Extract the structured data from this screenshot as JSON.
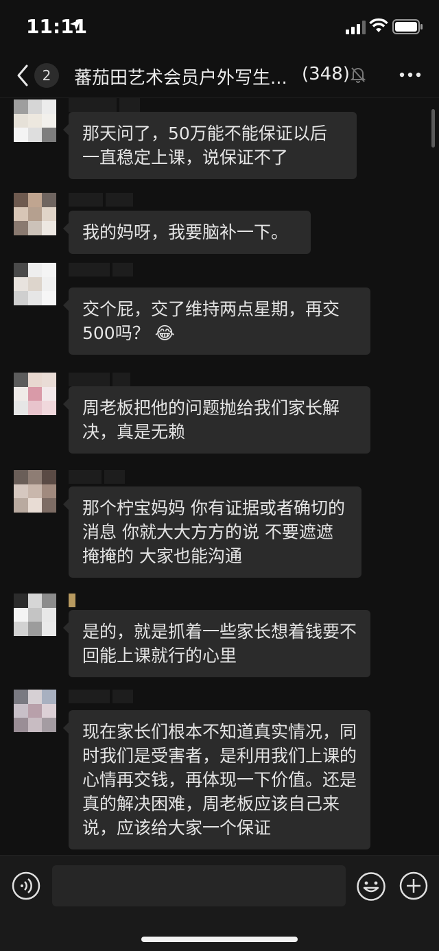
{
  "status_bar": {
    "time": "11:11"
  },
  "nav": {
    "unread_badge": "2",
    "title": "蕃茄田艺术会员户外写生...",
    "member_count": "(348)"
  },
  "messages": [
    {
      "text": "那天问了，50万能不能保证以后一直稳定上课，说保证不了"
    },
    {
      "text": "我的妈呀，我要脑补一下。"
    },
    {
      "text": "交个屁，交了维持两点星期，再交500吗？"
    },
    {
      "text": "周老板把他的问题抛给我们家长解决，真是无赖"
    },
    {
      "text": "那个柠宝妈妈 你有证据或者确切的消息 你就大大方方的说 不要遮遮掩掩的  大家也能沟通"
    },
    {
      "text": "是的，就是抓着一些家长想着钱要不回能上课就行的心里"
    },
    {
      "text": "现在家长们根本不知道真实情况，同时我们是受害者，是利用我们上课的心情再交钱，再体现一下价值。还是真的解决困难，周老板应该自己来说，应该给大家一个保证"
    }
  ],
  "input": {
    "placeholder": ""
  },
  "icons": {
    "back": "chevron-left-icon",
    "mute": "bell-muted-icon",
    "more": "more-dots-icon",
    "voice": "voice-icon",
    "emoji": "emoji-icon",
    "plus": "plus-icon",
    "crying_laughing": "😂"
  },
  "colors": {
    "background": "#111111",
    "bubble": "#2b2b2b",
    "text": "#e4e4e4"
  }
}
